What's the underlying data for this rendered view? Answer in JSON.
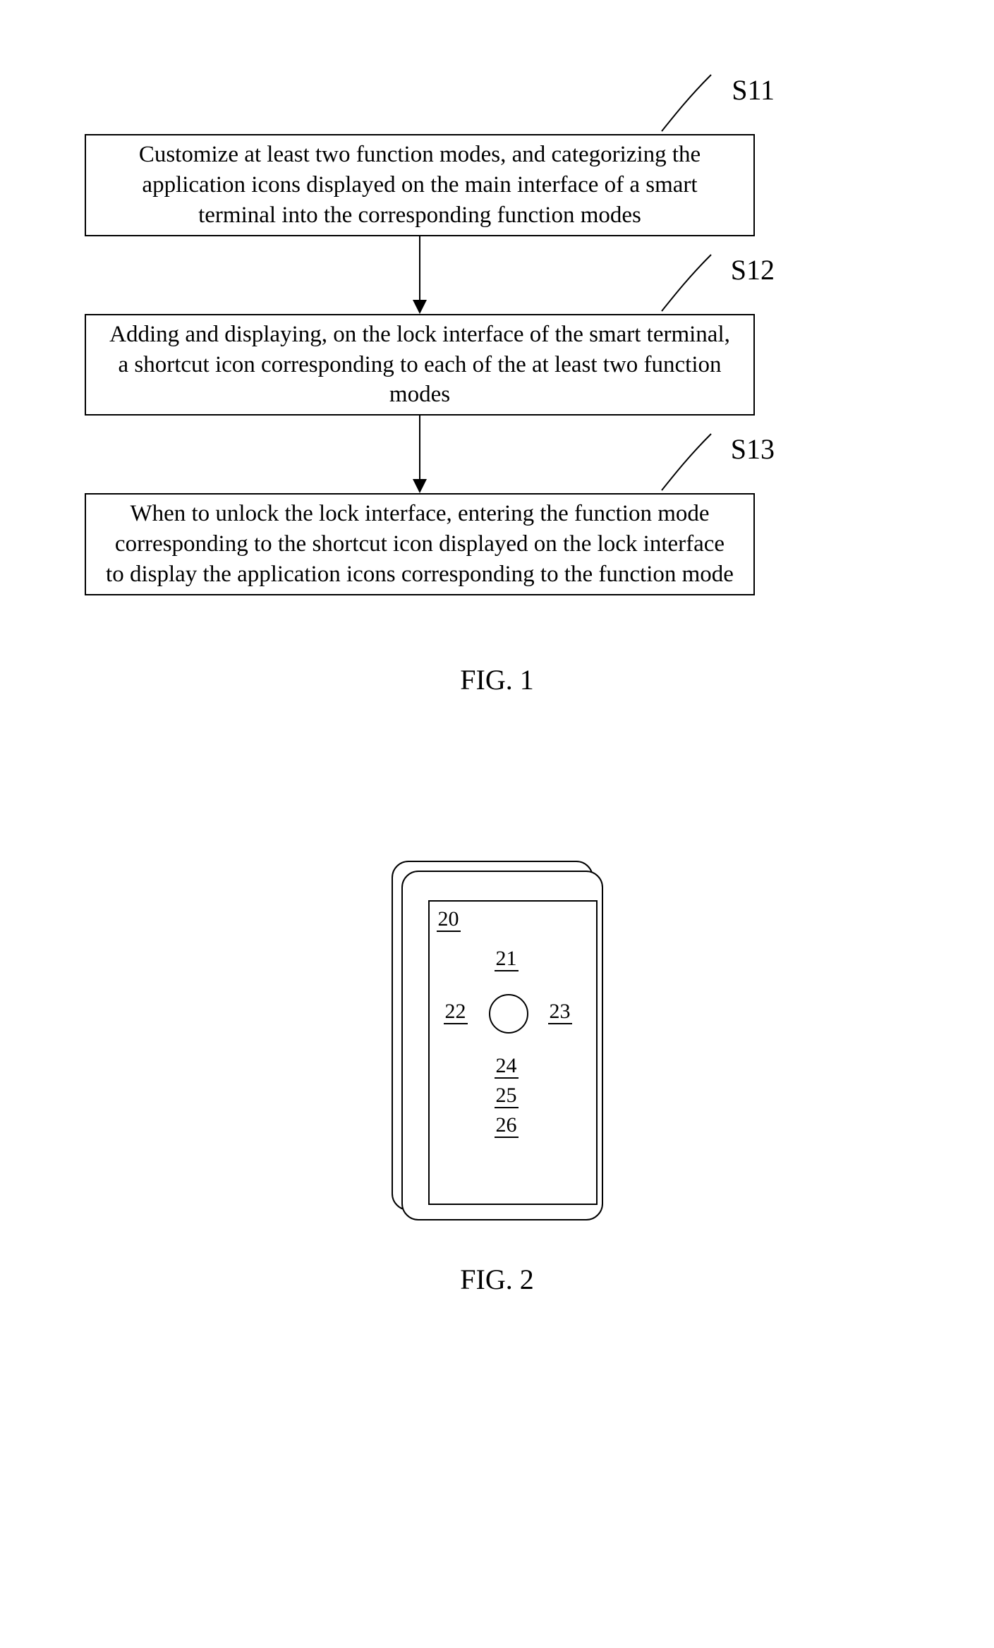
{
  "flowchart": {
    "steps": [
      {
        "id": "S11",
        "text": "Customize at least two function modes, and categorizing the application icons displayed on the main interface of a smart terminal into the corresponding function modes"
      },
      {
        "id": "S12",
        "text": "Adding and displaying, on the lock interface of the smart terminal, a shortcut icon corresponding to each of the at least two function modes"
      },
      {
        "id": "S13",
        "text": "When to unlock the lock interface, entering the function mode corresponding to the shortcut icon displayed on the lock interface to display the application icons corresponding to the function mode"
      }
    ],
    "caption": "FIG. 1"
  },
  "phone": {
    "refs": {
      "lock_interface": "20",
      "top": "21",
      "left": "22",
      "right": "23",
      "r24": "24",
      "r25": "25",
      "r26": "26"
    },
    "caption": "FIG. 2"
  }
}
